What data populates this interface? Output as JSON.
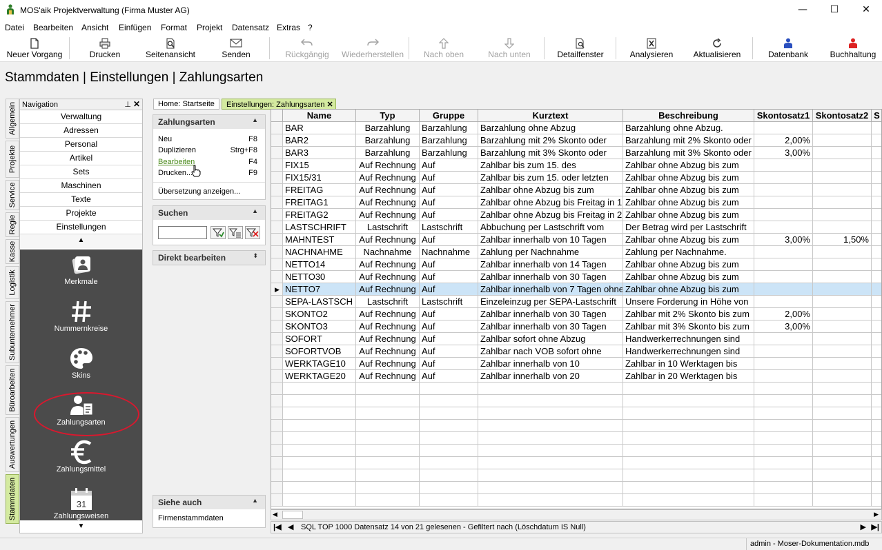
{
  "window": {
    "title": "MOS'aik Projektverwaltung (Firma Muster AG)",
    "minimize": "—",
    "maximize": "☐",
    "close": "✕"
  },
  "menu": [
    "Datei",
    "Bearbeiten",
    "Ansicht",
    "Einfügen",
    "Format",
    "Projekt",
    "Datensatz",
    "Extras",
    "?"
  ],
  "toolbar": {
    "items": [
      {
        "label": "Neuer Vorgang",
        "icon": "new-document-icon",
        "enabled": true
      },
      {
        "label": "Drucken",
        "icon": "printer-icon",
        "enabled": true
      },
      {
        "label": "Seitenansicht",
        "icon": "print-preview-icon",
        "enabled": true
      },
      {
        "label": "Senden",
        "icon": "envelope-icon",
        "enabled": true
      },
      {
        "label": "Rückgängig",
        "icon": "undo-icon",
        "enabled": false
      },
      {
        "label": "Wiederherstellen",
        "icon": "redo-icon",
        "enabled": false
      },
      {
        "label": "Nach oben",
        "icon": "arrow-up-icon",
        "enabled": false
      },
      {
        "label": "Nach unten",
        "icon": "arrow-down-icon",
        "enabled": false
      },
      {
        "label": "Detailfenster",
        "icon": "detail-window-icon",
        "enabled": true
      },
      {
        "label": "Analysieren",
        "icon": "analyze-icon",
        "enabled": true
      },
      {
        "label": "Aktualisieren",
        "icon": "refresh-icon",
        "enabled": true
      },
      {
        "label": "Datenbank",
        "icon": "database-user-icon",
        "enabled": true
      },
      {
        "label": "Buchhaltung",
        "icon": "accounting-user-icon",
        "enabled": true
      }
    ]
  },
  "page_title": "Stammdaten | Einstellungen | Zahlungsarten",
  "vertical_tabs": [
    "Allgemein",
    "Projekte",
    "Service",
    "Regie",
    "Kasse",
    "Logistik",
    "Subunternehmer",
    "Büroarbeiten",
    "Auswertungen",
    "Stammdaten"
  ],
  "vertical_tab_active": "Stammdaten",
  "navigation": {
    "title": "Navigation",
    "pin": "ᵖ",
    "close": "✕",
    "items": [
      "Verwaltung",
      "Adressen",
      "Personal",
      "Artikel",
      "Sets",
      "Maschinen",
      "Texte",
      "Projekte",
      "Einstellungen"
    ],
    "up": "▲",
    "down": "▼",
    "big_items": [
      {
        "label": "Merkmale",
        "icon": "merkmale-icon"
      },
      {
        "label": "Nummernkreise",
        "icon": "hash-icon"
      },
      {
        "label": "Skins",
        "icon": "palette-icon"
      },
      {
        "label": "Zahlungsarten",
        "icon": "payment-types-icon"
      },
      {
        "label": "Zahlungsmittel",
        "icon": "euro-icon"
      },
      {
        "label": "Zahlungsweisen",
        "icon": "calendar-icon",
        "calendar_day": "31"
      }
    ],
    "highlighted": "Zahlungsarten"
  },
  "tabs": [
    {
      "label": "Home: Startseite"
    },
    {
      "label": "Einstellungen: Zahlungsarten",
      "close": "✕"
    }
  ],
  "task_panels": {
    "zahlungsarten": {
      "title": "Zahlungsarten",
      "arrow": "▲",
      "items": [
        {
          "label": "Neu",
          "key": "F8"
        },
        {
          "label": "Duplizieren",
          "key": "Strg+F8"
        },
        {
          "label": "Bearbeiten",
          "key": "F4"
        },
        {
          "label": "Drucken...",
          "key": "F9"
        }
      ],
      "extra": "Übersetzung anzeigen..."
    },
    "suchen": {
      "title": "Suchen",
      "arrow": "▲",
      "value": ""
    },
    "direkt": {
      "title": "Direkt bearbeiten",
      "arrow": "⬍"
    },
    "siehe": {
      "title": "Siehe auch",
      "arrow": "▲",
      "items": [
        "Firmenstammdaten"
      ]
    }
  },
  "grid": {
    "columns": [
      "Name",
      "Typ",
      "Gruppe",
      "Kurztext",
      "Beschreibung",
      "Skontosatz1",
      "Skontosatz2",
      "S"
    ],
    "selected_row": 13,
    "rows": [
      [
        "BAR",
        "Barzahlung",
        "Barzahlung",
        "Barzahlung ohne Abzug",
        "Barzahlung ohne Abzug.",
        "",
        ""
      ],
      [
        "BAR2",
        "Barzahlung",
        "Barzahlung",
        "Barzahlung mit 2% Skonto oder",
        "Barzahlung mit 2% Skonto oder",
        "2,00%",
        ""
      ],
      [
        "BAR3",
        "Barzahlung",
        "Barzahlung",
        "Barzahlung mit 3% Skonto oder",
        "Barzahlung mit 3% Skonto oder",
        "3,00%",
        ""
      ],
      [
        "FIX15",
        "Auf Rechnung",
        "Auf",
        "Zahlbar bis zum 15. des",
        "Zahlbar ohne Abzug bis zum",
        "",
        ""
      ],
      [
        "FIX15/31",
        "Auf Rechnung",
        "Auf",
        "Zahlbar bis zum 15. oder letzten",
        "Zahlbar ohne Abzug bis zum",
        "",
        ""
      ],
      [
        "FREITAG",
        "Auf Rechnung",
        "Auf",
        "Zahlbar ohne Abzug bis zum",
        "Zahlbar ohne Abzug bis zum",
        "",
        ""
      ],
      [
        "FREITAG1",
        "Auf Rechnung",
        "Auf",
        "Zahlbar ohne Abzug bis Freitag in 1",
        "Zahlbar ohne Abzug bis zum",
        "",
        ""
      ],
      [
        "FREITAG2",
        "Auf Rechnung",
        "Auf",
        "Zahlbar ohne Abzug bis Freitag in 2",
        "Zahlbar ohne Abzug bis zum",
        "",
        ""
      ],
      [
        "LASTSCHRIFT",
        "Lastschrift",
        "Lastschrift",
        "Abbuchung per Lastschrift vom",
        "Der Betrag wird per Lastschrift",
        "",
        ""
      ],
      [
        "MAHNTEST",
        "Auf Rechnung",
        "Auf",
        "Zahlbar innerhalb von 10 Tagen",
        "Zahlbar ohne Abzug bis zum",
        "3,00%",
        "1,50%"
      ],
      [
        "NACHNAHME",
        "Nachnahme",
        "Nachnahme",
        "Zahlung per Nachnahme",
        "Zahlung per Nachnahme.",
        "",
        ""
      ],
      [
        "NETTO14",
        "Auf Rechnung",
        "Auf",
        "Zahlbar innerhalb von 14 Tagen",
        "Zahlbar ohne Abzug bis zum",
        "",
        ""
      ],
      [
        "NETTO30",
        "Auf Rechnung",
        "Auf",
        "Zahlbar innerhalb von 30 Tagen",
        "Zahlbar ohne Abzug bis zum",
        "",
        ""
      ],
      [
        "NETTO7",
        "Auf Rechnung",
        "Auf",
        "Zahlbar innerhalb von 7 Tagen ohne",
        "Zahlbar ohne Abzug bis zum",
        "",
        ""
      ],
      [
        "SEPA-LASTSCH",
        "Lastschrift",
        "Lastschrift",
        "Einzeleinzug per SEPA-Lastschrift",
        "Unsere Forderung in Höhe von",
        "",
        ""
      ],
      [
        "SKONTO2",
        "Auf Rechnung",
        "Auf",
        "Zahlbar innerhalb von 30 Tagen",
        "Zahlbar mit 2% Skonto bis zum",
        "2,00%",
        ""
      ],
      [
        "SKONTO3",
        "Auf Rechnung",
        "Auf",
        "Zahlbar innerhalb von 30 Tagen",
        "Zahlbar mit 3% Skonto bis zum",
        "3,00%",
        ""
      ],
      [
        "SOFORT",
        "Auf Rechnung",
        "Auf",
        "Zahlbar sofort ohne Abzug",
        "Handwerkerrechnungen sind",
        "",
        ""
      ],
      [
        "SOFORTVOB",
        "Auf Rechnung",
        "Auf",
        "Zahlbar nach VOB sofort ohne",
        "Handwerkerrechnungen sind",
        "",
        ""
      ],
      [
        "WERKTAGE10",
        "Auf Rechnung",
        "Auf",
        "Zahlbar innerhalb von 10",
        "Zahlbar in 10 Werktagen bis",
        "",
        ""
      ],
      [
        "WERKTAGE20",
        "Auf Rechnung",
        "Auf",
        "Zahlbar innerhalb von 20",
        "Zahlbar in 20 Werktagen bis",
        "",
        ""
      ]
    ]
  },
  "record_status": "SQL TOP 1000 Datensatz 14 von 21 gelesenen - Gefiltert nach (Löschdatum IS Null)",
  "statusbar": "admin - Moser-Dokumentation.mdb",
  "colors": {
    "accent_tab": "#d4eaa0",
    "selected_row": "#cce4f7",
    "nav_dark": "#4b4b4b",
    "highlight_circle": "#d9182e",
    "link_green": "#4a8a1a"
  }
}
